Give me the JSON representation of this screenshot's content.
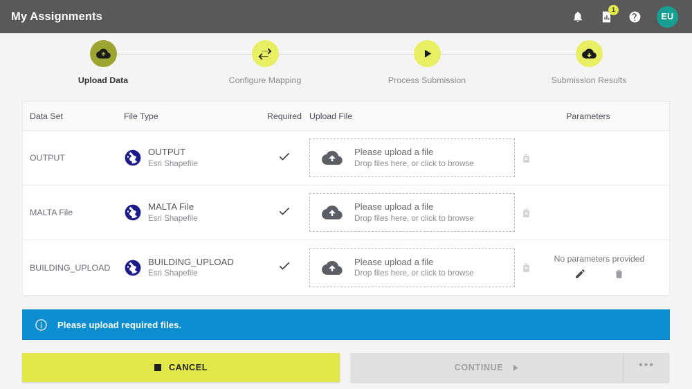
{
  "header": {
    "title": "My Assignments",
    "icons": [
      {
        "name": "notifications-icon",
        "glyph": "bell"
      },
      {
        "name": "reports-icon",
        "glyph": "report-chart",
        "badge": "1"
      },
      {
        "name": "help-icon",
        "glyph": "question-circle"
      }
    ],
    "avatar": {
      "initials": "EU"
    },
    "colors": {
      "bar": "#595959",
      "badge": "#e3e84a",
      "avatar": "#179f93"
    }
  },
  "stepper": {
    "steps": [
      {
        "label": "Upload Data",
        "icon": "cloud-upload-icon",
        "state": "active"
      },
      {
        "label": "Configure Mapping",
        "icon": "transfer-icon",
        "state": "idle"
      },
      {
        "label": "Process Submission",
        "icon": "play-icon",
        "state": "idle"
      },
      {
        "label": "Submission Results",
        "icon": "cloud-download-icon",
        "state": "idle"
      }
    ],
    "colors": {
      "active": "#9ba52f",
      "idle": "#e9ef62"
    }
  },
  "table": {
    "columns": {
      "dataset": "Data Set",
      "filetype": "File Type",
      "required": "Required",
      "upload": "Upload File",
      "parameters": "Parameters"
    },
    "rows": [
      {
        "dataset": "OUTPUT",
        "filetype_name": "OUTPUT",
        "filetype_sub": "Esri Shapefile",
        "required": true,
        "upload_title": "Please upload a file",
        "upload_hint": "Drop files here, or click to browse",
        "parameters_text": "",
        "has_parameter_actions": false
      },
      {
        "dataset": "MALTA File",
        "filetype_name": "MALTA File",
        "filetype_sub": "Esri Shapefile",
        "required": true,
        "upload_title": "Please upload a file",
        "upload_hint": "Drop files here, or click to browse",
        "parameters_text": "",
        "has_parameter_actions": false
      },
      {
        "dataset": "BUILDING_UPLOAD",
        "filetype_name": "BUILDING_UPLOAD",
        "filetype_sub": "Esri Shapefile",
        "required": true,
        "upload_title": "Please upload a file",
        "upload_hint": "Drop files here, or click to browse",
        "parameters_text": "No parameters provided",
        "has_parameter_actions": true
      }
    ]
  },
  "banner": {
    "icon": "info-circle-icon",
    "text": "Please upload required files.",
    "color": "#0c8ed0"
  },
  "footer": {
    "cancel_label": "CANCEL",
    "cancel_icon": "stop-square-icon",
    "continue_label": "CONTINUE",
    "continue_icon": "play-icon",
    "continue_disabled": true,
    "more_label": "•••",
    "colors": {
      "cancel": "#e3e84a",
      "continue": "#e0e0e0"
    }
  }
}
